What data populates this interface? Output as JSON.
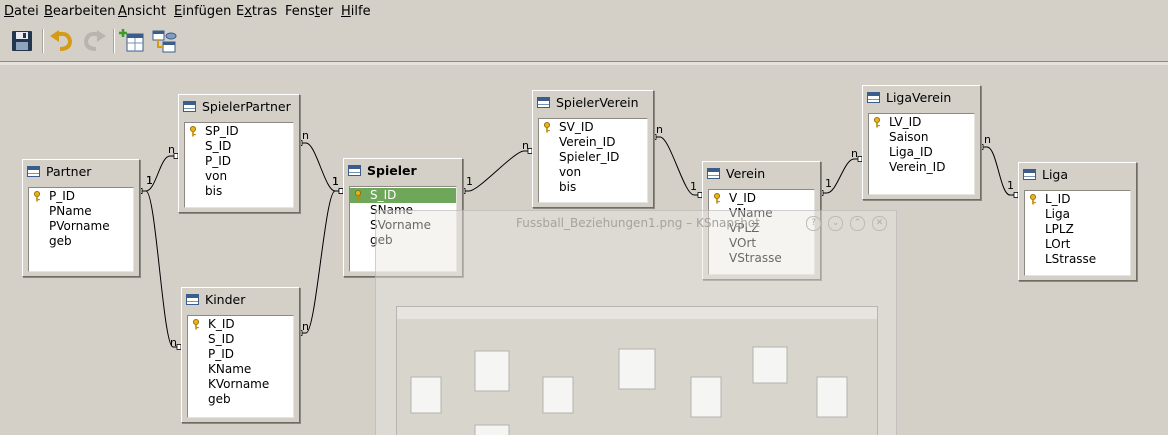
{
  "menu": [
    {
      "pre": "",
      "u": "D",
      "post": "atei"
    },
    {
      "pre": "",
      "u": "B",
      "post": "earbeiten"
    },
    {
      "pre": "",
      "u": "A",
      "post": "nsicht"
    },
    {
      "pre": "",
      "u": "E",
      "post": "infügen"
    },
    {
      "pre": "E",
      "u": "x",
      "post": "tras"
    },
    {
      "pre": "Fens",
      "u": "t",
      "post": "er"
    },
    {
      "pre": "",
      "u": "H",
      "post": "ilfe"
    }
  ],
  "toolbar": {
    "save_icon": "floppy-disk-icon",
    "undo_icon": "undo-arrow-icon",
    "redo_icon": "redo-arrow-icon",
    "add_table_icon": "add-table-icon",
    "relation_icon": "new-relation-icon"
  },
  "tables": [
    {
      "title": "Partner",
      "fields": [
        "P_ID",
        "PName",
        "PVorname",
        "geb"
      ],
      "key_field": 0
    },
    {
      "title": "SpielerPartner",
      "fields": [
        "SP_ID",
        "S_ID",
        "P_ID",
        "von",
        "bis"
      ],
      "key_field": 0
    },
    {
      "title": "Kinder",
      "fields": [
        "K_ID",
        "S_ID",
        "P_ID",
        "KName",
        "KVorname",
        "geb"
      ],
      "key_field": 0
    },
    {
      "title": "Spieler",
      "fields": [
        "S_ID",
        "SName",
        "SVorname",
        "geb"
      ],
      "key_field": 0,
      "selected_field": 0
    },
    {
      "title": "SpielerVerein",
      "fields": [
        "SV_ID",
        "Verein_ID",
        "Spieler_ID",
        "von",
        "bis"
      ],
      "key_field": 0
    },
    {
      "title": "Verein",
      "fields": [
        "V_ID",
        "VName",
        "VPLZ",
        "VOrt",
        "VStrasse"
      ],
      "key_field": 0
    },
    {
      "title": "LigaVerein",
      "fields": [
        "LV_ID",
        "Saison",
        "Liga_ID",
        "Verein_ID"
      ],
      "key_field": 0
    },
    {
      "title": "Liga",
      "fields": [
        "L_ID",
        "Liga",
        "LPLZ",
        "LOrt",
        "LStrasse"
      ],
      "key_field": 0
    }
  ],
  "relations": [
    {
      "from": "Partner",
      "to": "SpielerPartner",
      "from_card": "1",
      "to_card": "n"
    },
    {
      "from": "Partner",
      "to": "Kinder",
      "from_card": "1",
      "to_card": "n"
    },
    {
      "from": "SpielerPartner",
      "to": "Spieler",
      "from_card": "n",
      "to_card": "1"
    },
    {
      "from": "Kinder",
      "to": "Spieler",
      "from_card": "n",
      "to_card": "1"
    },
    {
      "from": "Spieler",
      "to": "SpielerVerein",
      "from_card": "1",
      "to_card": "n"
    },
    {
      "from": "SpielerVerein",
      "to": "Verein",
      "from_card": "n",
      "to_card": "1"
    },
    {
      "from": "Verein",
      "to": "LigaVerein",
      "from_card": "1",
      "to_card": "n"
    },
    {
      "from": "LigaVerein",
      "to": "Liga",
      "from_card": "n",
      "to_card": "1"
    }
  ],
  "overlay": {
    "title": "Fussball_Beziehungen1.png – KSnapshot",
    "buttons": [
      "?",
      "⌄",
      "⌃",
      "✕"
    ]
  }
}
